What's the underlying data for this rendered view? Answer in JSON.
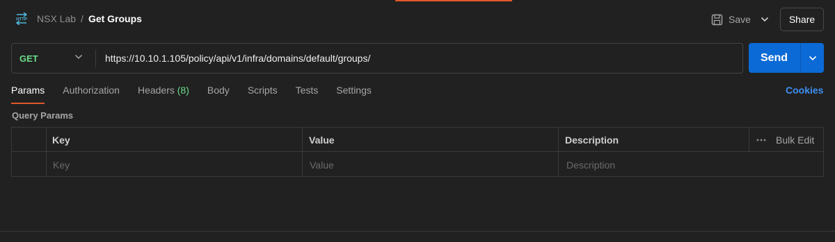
{
  "header": {
    "icon": "http-icon",
    "breadcrumb_parent": "NSX Lab",
    "breadcrumb_separator": "/",
    "title": "Get Groups",
    "save_label": "Save",
    "share_label": "Share"
  },
  "request": {
    "method": "GET",
    "url": "https://10.10.1.105/policy/api/v1/infra/domains/default/groups/",
    "send_label": "Send"
  },
  "tabs": [
    {
      "label": "Params",
      "active": true
    },
    {
      "label": "Authorization"
    },
    {
      "label": "Headers",
      "count": "(8)"
    },
    {
      "label": "Body"
    },
    {
      "label": "Scripts"
    },
    {
      "label": "Tests"
    },
    {
      "label": "Settings"
    }
  ],
  "cookies_label": "Cookies",
  "query_params": {
    "title": "Query Params",
    "columns": [
      "Key",
      "Value",
      "Description"
    ],
    "bulk_edit_label": "Bulk Edit",
    "placeholders": {
      "key": "Key",
      "value": "Value",
      "description": "Description"
    }
  },
  "colors": {
    "accent": "#e0592a",
    "method_get": "#6bdd8a",
    "send": "#0b6ad6",
    "link": "#3e8ff0"
  }
}
